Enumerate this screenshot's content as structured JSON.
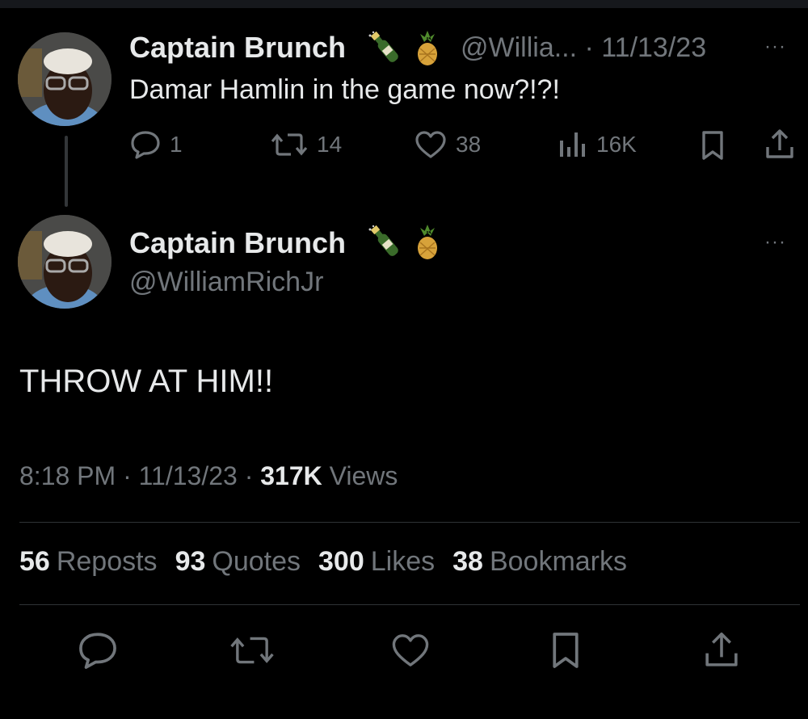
{
  "reply_tweet": {
    "name": "Captain Brunch",
    "handle_date": "@Willia... · 11/13/23",
    "text": "Damar Hamlin in the game now?!?!",
    "more": "···",
    "counts": {
      "replies": "1",
      "reposts": "14",
      "likes": "38",
      "views": "16K"
    }
  },
  "main_tweet": {
    "name": "Captain Brunch",
    "handle": "@WilliamRichJr",
    "more": "···",
    "text": "THROW AT HIM!!",
    "time": "8:18 PM · 11/13/23 · ",
    "views_count": "317K",
    "views_label": " Views",
    "stats": [
      {
        "count": "56",
        "label": "Reposts"
      },
      {
        "count": "93",
        "label": "Quotes"
      },
      {
        "count": "300",
        "label": "Likes"
      },
      {
        "count": "38",
        "label": "Bookmarks"
      }
    ]
  },
  "icons": [
    "reply-icon",
    "repost-icon",
    "like-icon",
    "views-icon",
    "bookmark-icon",
    "share-icon",
    "champagne-icon",
    "pineapple-icon"
  ],
  "colors": {
    "background": "#000000",
    "text": "#e7e9ea",
    "muted": "#71767b",
    "divider": "#2f3336"
  }
}
